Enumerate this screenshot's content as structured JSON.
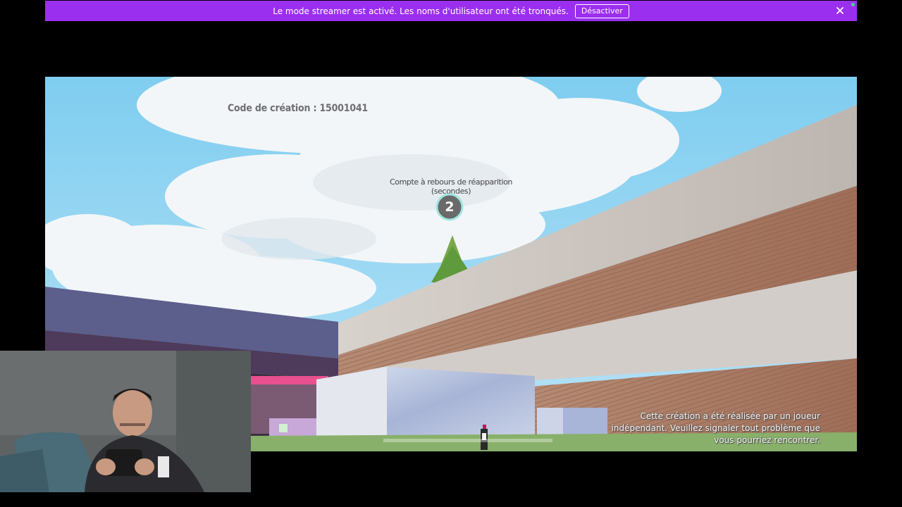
{
  "banner": {
    "message": "Le mode streamer est activé. Les noms d'utilisateur ont été tronqués.",
    "disable_label": "Désactiver",
    "close_icon": "close-icon",
    "background": "#9b2ff0"
  },
  "game": {
    "creation_code": "Code de création : 15001041",
    "countdown_label": "Compte à rebours de réapparition (secondes)",
    "countdown_value": "2",
    "disclaimer": "Cette création a été réalisée par un joueur indépendant. Veuillez signaler tout problème que vous pourriez rencontrer."
  },
  "webcam": {
    "icon": "webcam-feed"
  }
}
